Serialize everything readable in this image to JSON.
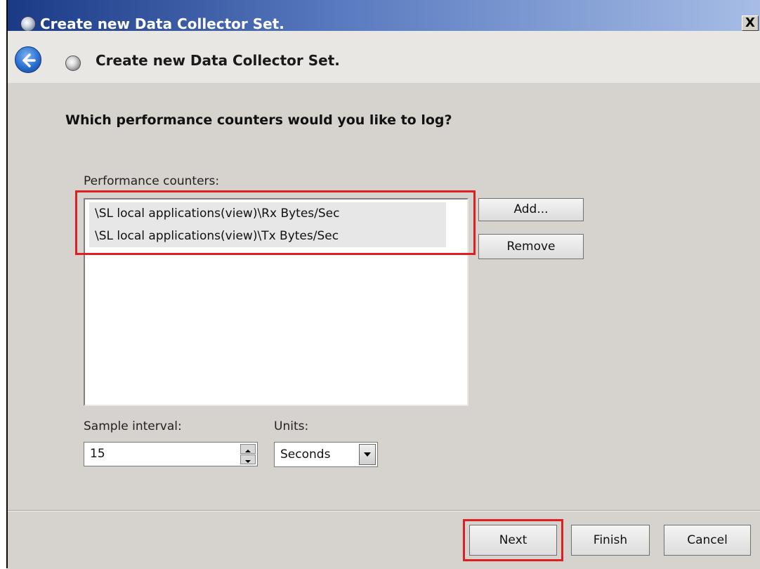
{
  "window": {
    "title": "Create new Data Collector Set.",
    "close_label": "X"
  },
  "header": {
    "title": "Create new Data Collector Set."
  },
  "question": "Which performance counters would you like to log?",
  "counters": {
    "label": "Performance counters:",
    "items": [
      "\\SL local applications(view)\\Rx Bytes/Sec",
      "\\SL local applications(view)\\Tx Bytes/Sec"
    ],
    "add_label": "Add...",
    "remove_label": "Remove"
  },
  "sample": {
    "label": "Sample interval:",
    "value": "15",
    "units_label": "Units:",
    "units_value": "Seconds"
  },
  "footer": {
    "next_label": "Next",
    "finish_label": "Finish",
    "cancel_label": "Cancel"
  },
  "colors": {
    "highlight": "#e02020",
    "title_gradient_start": "#1a3a86"
  },
  "icons": [
    "data-collector-icon",
    "back-arrow-icon",
    "close-icon",
    "spin-up-icon",
    "spin-down-icon",
    "dropdown-arrow-icon"
  ]
}
